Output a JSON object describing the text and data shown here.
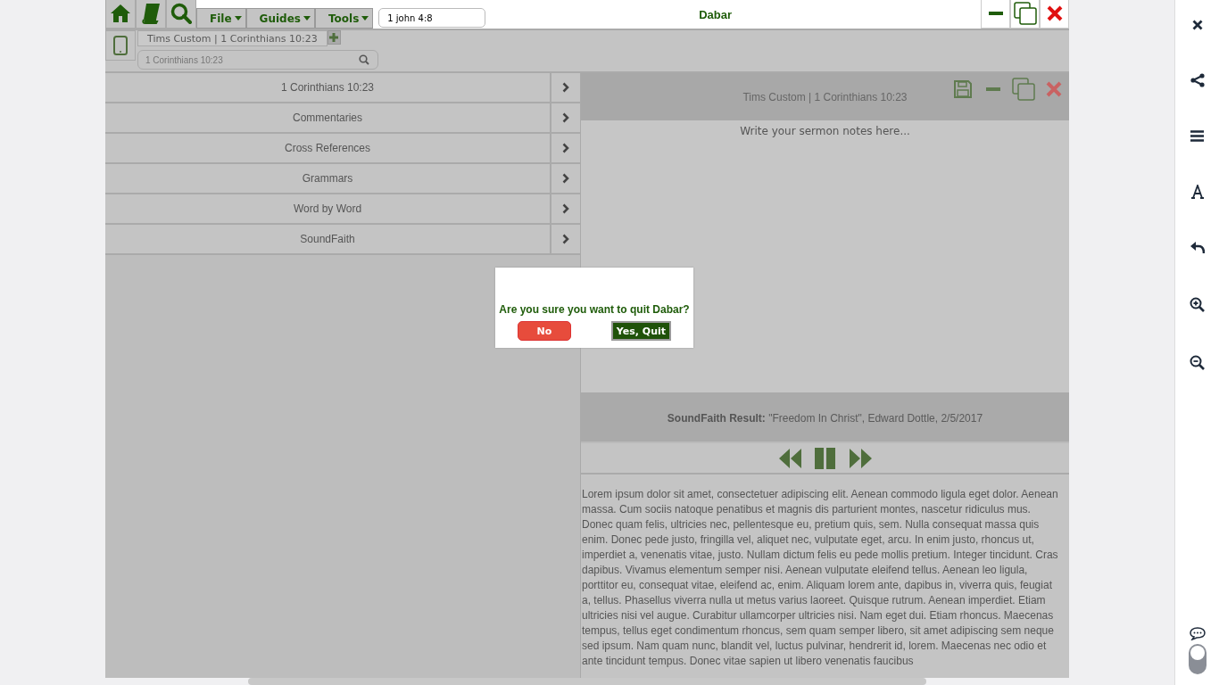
{
  "window": {
    "title": "Dabar"
  },
  "menus": [
    "File",
    "Guides",
    "Tools"
  ],
  "reference_field": {
    "value": "1 john 4:8"
  },
  "tabs": [
    {
      "label": "Tims Custom | 1 Corinthians 10:23",
      "selected": true
    }
  ],
  "passage_search": {
    "placeholder": "1 Corinthians 10:23"
  },
  "sections": [
    {
      "label": "1 Corinthians 10:23"
    },
    {
      "label": "Commentaries"
    },
    {
      "label": "Cross References"
    },
    {
      "label": "Grammars"
    },
    {
      "label": "Word by Word"
    },
    {
      "label": "SoundFaith"
    }
  ],
  "notes_panel": {
    "title": "Tims Custom | 1 Corinthians 10:23",
    "placeholder": "Write your sermon notes here..."
  },
  "result": {
    "label": "SoundFaith Result:",
    "value": "\"Freedom In Christ\", Edward Dottle, 2/5/2017"
  },
  "player": {
    "playing": true
  },
  "body_text": "Lorem ipsum dolor sit amet, consectetuer adipiscing elit. Aenean commodo ligula eget dolor. Aenean massa. Cum sociis natoque penatibus et magnis dis parturient montes, nascetur ridiculus mus. Donec quam felis, ultricies nec, pellentesque eu, pretium quis, sem. Nulla consequat massa quis enim. Donec pede justo, fringilla vel, aliquet nec, vulputate eget, arcu. In enim justo, rhoncus ut, imperdiet a, venenatis vitae, justo. Nullam dictum felis eu pede mollis pretium. Integer tincidunt. Cras dapibus. Vivamus elementum semper nisi. Aenean vulputate eleifend tellus. Aenean leo ligula, porttitor eu, consequat vitae, eleifend ac, enim. Aliquam lorem ante, dapibus in, viverra quis, feugiat a, tellus. Phasellus viverra nulla ut metus varius laoreet. Quisque rutrum. Aenean imperdiet. Etiam ultricies nisi vel augue. Curabitur ullamcorper ultricies nisi. Nam eget dui. Etiam rhoncus. Maecenas tempus, tellus eget condimentum rhoncus, sem quam semper libero, sit amet adipiscing sem neque sed ipsum. Nam quam nunc, blandit vel, luctus pulvinar, hendrerit id, lorem. Maecenas nec odio et ante tincidunt tempus. Donec vitae sapien ut libero venenatis faucibus",
  "dialog": {
    "message": "Are you sure you want to quit Dabar?",
    "buttons": [
      {
        "label": "No",
        "kind": "cancel"
      },
      {
        "label": "Yes, Quit",
        "kind": "confirm"
      }
    ]
  },
  "side_toggle": {
    "on": false
  }
}
